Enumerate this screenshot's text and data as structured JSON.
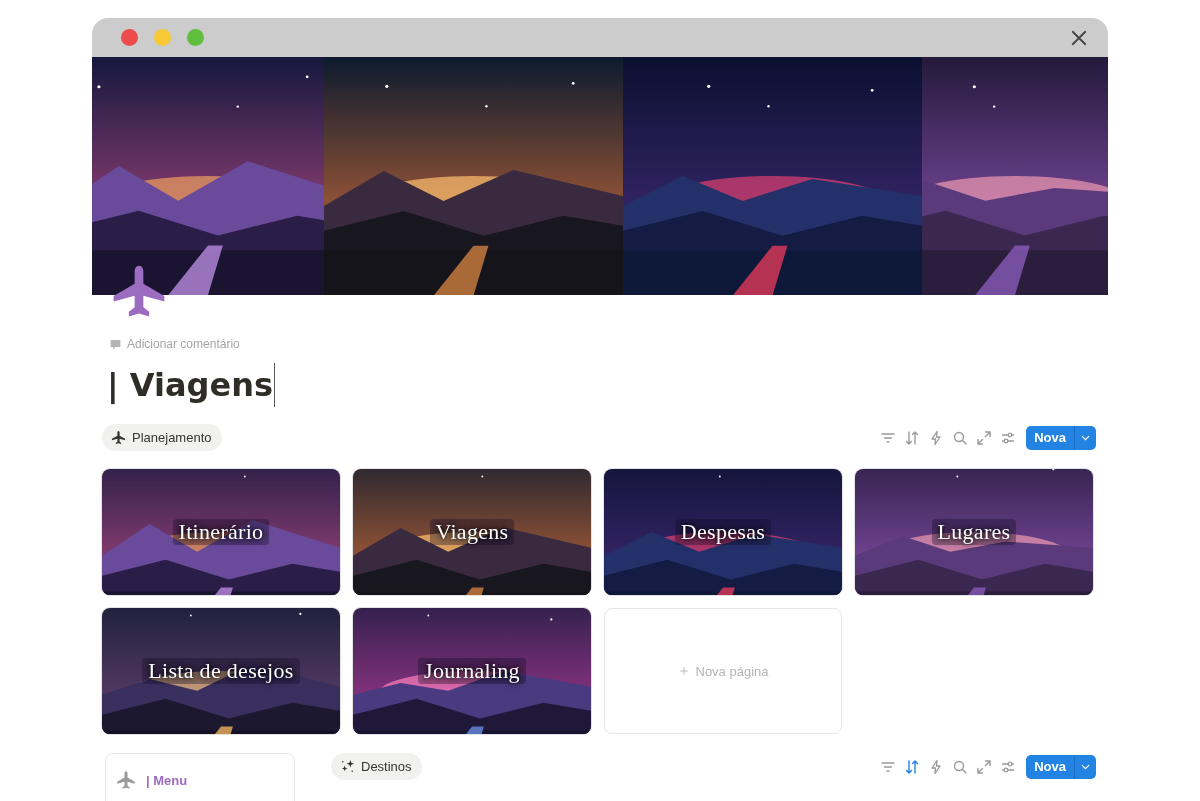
{
  "comment_link": "Adicionar comentário",
  "title": "| Viagens",
  "sections": [
    {
      "tag": "Planejamento",
      "toolbar": {
        "sort_active": false,
        "button": "Nova"
      },
      "cards": [
        {
          "kind": "picture",
          "title": "Itinerário"
        },
        {
          "kind": "picture",
          "title": "Viagens"
        },
        {
          "kind": "picture",
          "title": "Despesas"
        },
        {
          "kind": "picture",
          "title": "Lugares"
        },
        {
          "kind": "picture",
          "title": "Lista de desejos"
        },
        {
          "kind": "picture",
          "title": "Journaling"
        },
        {
          "kind": "new",
          "title": "Nova página"
        }
      ]
    },
    {
      "tag": "Destinos",
      "toolbar": {
        "sort_active": true,
        "button": "Nova"
      }
    }
  ],
  "menu_link": "| Menu"
}
